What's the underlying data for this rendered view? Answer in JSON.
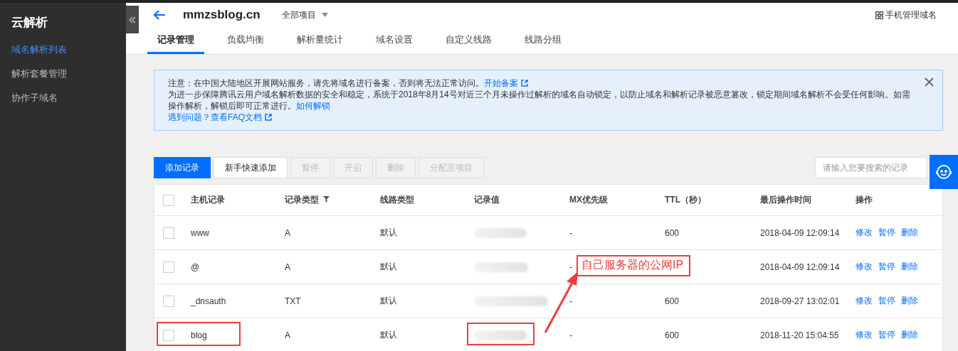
{
  "sidebar": {
    "title": "云解析",
    "items": [
      {
        "label": "域名解析列表",
        "selected": true
      },
      {
        "label": "解析套餐管理",
        "selected": false
      },
      {
        "label": "协作子域名",
        "selected": false
      }
    ]
  },
  "header": {
    "domain": "mmzsblog.cn",
    "project": "全部项目",
    "mobile_link": "手机管理域名"
  },
  "tabs": [
    {
      "label": "记录管理",
      "selected": true
    },
    {
      "label": "负载均衡",
      "selected": false
    },
    {
      "label": "解析量统计",
      "selected": false
    },
    {
      "label": "域名设置",
      "selected": false
    },
    {
      "label": "自定义线路",
      "selected": false
    },
    {
      "label": "线路分组",
      "selected": false
    }
  ],
  "notice": {
    "lines": [
      {
        "text": "注意：在中国大陆地区开展网站服务，请先将域名进行备案，否则将无法正常访问。",
        "link": "开始备案",
        "external": true
      },
      {
        "text": "为进一步保障腾讯云用户域名解析数据的安全和稳定，系统于2018年8月14号对近三个月未操作过解析的域名自动锁定，以防止域名和解析记录被恶意篡改，锁定期间域名解析不会受任何影响。如需操作解析，解锁后即可正常进行。",
        "link": "如何解锁",
        "external": false
      },
      {
        "link": "遇到问题？查看FAQ文档",
        "external": true
      }
    ]
  },
  "toolbar": {
    "buttons": [
      {
        "label": "添加记录",
        "primary": true,
        "disabled": false
      },
      {
        "label": "新手快速添加",
        "primary": false,
        "disabled": false
      },
      {
        "label": "暂停",
        "primary": false,
        "disabled": true
      },
      {
        "label": "开启",
        "primary": false,
        "disabled": true
      },
      {
        "label": "删除",
        "primary": false,
        "disabled": true
      },
      {
        "label": "分配至项目",
        "primary": false,
        "disabled": true
      }
    ],
    "search": {
      "placeholder": "请输入您要搜索的记录"
    }
  },
  "table": {
    "header_checked": false,
    "columns": [
      "主机记录",
      "记录类型",
      "线路类型",
      "记录值",
      "MX优先级",
      "TTL（秒）",
      "最后操作时间",
      "操作"
    ],
    "rows": [
      {
        "checked": false,
        "highlighted": false,
        "host": "www",
        "type": "A",
        "line": "默认",
        "mx": "-",
        "ttl": "600",
        "time": "2018-04-09 12:09:14",
        "actions": [
          "修改",
          "暂停",
          "删除"
        ]
      },
      {
        "checked": false,
        "highlighted": false,
        "host": "@",
        "type": "A",
        "line": "默认",
        "mx": "-",
        "time": "2018-04-09 12:09:14",
        "actions": [
          "修改",
          "暂停",
          "删除"
        ]
      },
      {
        "checked": false,
        "highlighted": false,
        "host": "_dnsauth",
        "type": "TXT",
        "line": "默认",
        "mx": "-",
        "ttl": "600",
        "time": "2018-09-27 13:02:01",
        "actions": [
          "修改",
          "暂停",
          "删除"
        ]
      },
      {
        "checked": false,
        "highlighted": true,
        "host": "blog",
        "type": "A",
        "line": "默认",
        "mx": "-",
        "ttl": "600",
        "time": "2018-11-20 15:04:55",
        "actions": [
          "修改",
          "暂停",
          "删除"
        ]
      }
    ]
  },
  "annotation": {
    "text": "自己服务器的公网IP"
  }
}
